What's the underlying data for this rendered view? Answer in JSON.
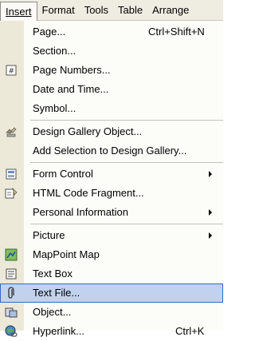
{
  "menubar": {
    "items": [
      "Insert",
      "Format",
      "Tools",
      "Table",
      "Arrange"
    ],
    "active": "Insert"
  },
  "menu": {
    "items": [
      {
        "label": "Page...",
        "shortcut": "Ctrl+Shift+N"
      },
      {
        "label": "Section..."
      },
      {
        "label": "Page Numbers...",
        "icon": "page-numbers-icon"
      },
      {
        "label": "Date and Time..."
      },
      {
        "label": "Symbol..."
      },
      {
        "label": "Design Gallery Object...",
        "icon": "design-gallery-icon"
      },
      {
        "label": "Add Selection to Design Gallery..."
      },
      {
        "label": "Form Control",
        "icon": "form-control-icon",
        "submenu": true
      },
      {
        "label": "HTML Code Fragment...",
        "icon": "html-fragment-icon"
      },
      {
        "label": "Personal Information",
        "submenu": true
      },
      {
        "label": "Picture",
        "submenu": true
      },
      {
        "label": "MapPoint Map",
        "icon": "mappoint-icon"
      },
      {
        "label": "Text Box",
        "icon": "text-box-icon"
      },
      {
        "label": "Text File...",
        "icon": "paperclip-icon",
        "highlighted": true
      },
      {
        "label": "Object...",
        "icon": "object-icon"
      },
      {
        "label": "Hyperlink...",
        "icon": "hyperlink-icon",
        "shortcut": "Ctrl+K"
      }
    ]
  },
  "colors": {
    "highlight": "#c1d2ee",
    "highlight_border": "#316ac5",
    "gutter": "#ece9d8",
    "menubar": "#efede2"
  }
}
